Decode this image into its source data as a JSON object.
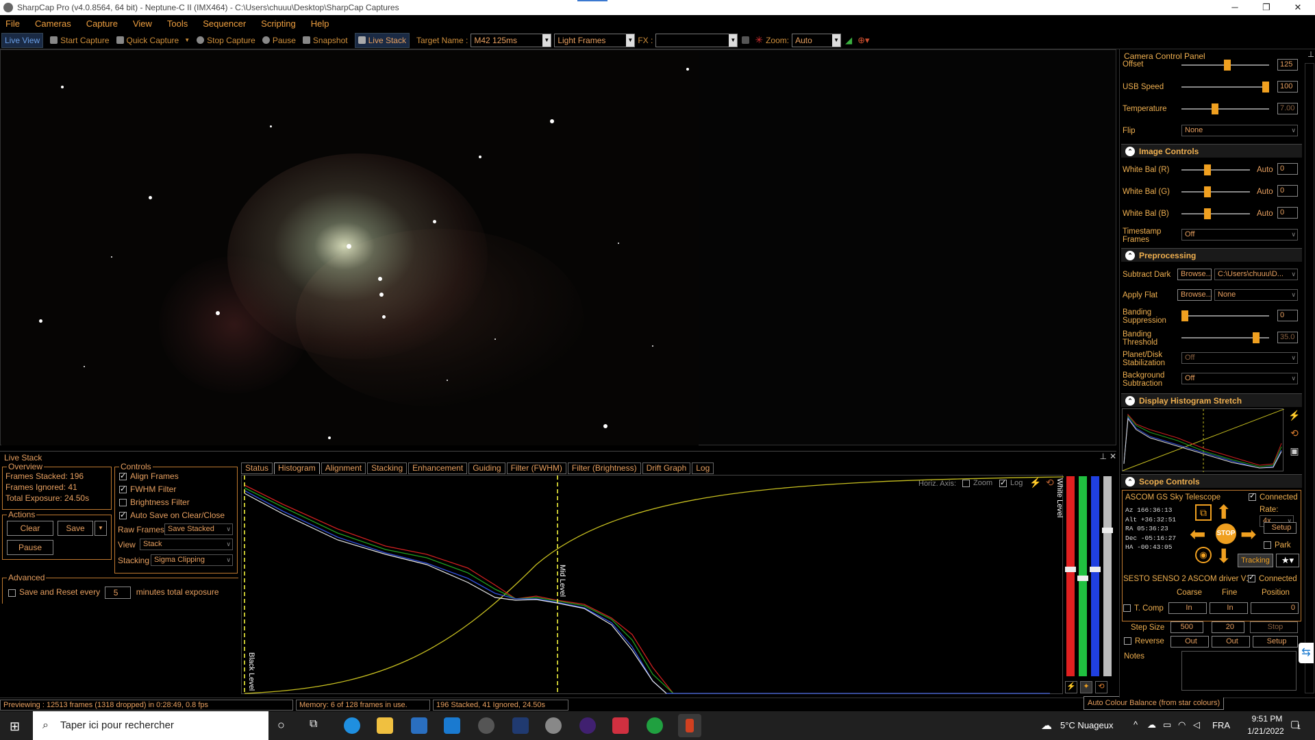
{
  "window": {
    "title": "SharpCap Pro (v4.0.8564, 64 bit) - Neptune-C II (IMX464) - C:\\Users\\chuuu\\Desktop\\SharpCap Captures"
  },
  "menu": [
    "File",
    "Cameras",
    "Capture",
    "View",
    "Tools",
    "Sequencer",
    "Scripting",
    "Help"
  ],
  "toolbar": {
    "live_view": "Live View",
    "start_capture": "Start Capture",
    "quick_capture": "Quick Capture",
    "stop_capture": "Stop Capture",
    "pause": "Pause",
    "snapshot": "Snapshot",
    "live_stack": "Live Stack",
    "target_label": "Target Name :",
    "target_value": "M42 125ms",
    "frame_type": "Light Frames",
    "fx_label": "FX :",
    "fx_value": "",
    "zoom_label": "Zoom:",
    "zoom_value": "Auto"
  },
  "livestack": {
    "title": "Live Stack",
    "overview": {
      "label": "Overview",
      "frames_stacked": "Frames Stacked: 196",
      "frames_ignored": "Frames Ignored:  41",
      "total_exposure": "Total Exposure:   24.50s"
    },
    "actions": {
      "label": "Actions",
      "clear": "Clear",
      "save": "Save",
      "pause": "Pause"
    },
    "advanced": {
      "label": "Advanced",
      "save_reset": "Save and Reset every",
      "minutes": "5",
      "minutes_suffix": "minutes total exposure"
    },
    "controls": {
      "label": "Controls",
      "align_frames": "Align Frames",
      "fwhm_filter": "FWHM Filter",
      "brightness_filter": "Brightness Filter",
      "auto_save": "Auto Save on Clear/Close",
      "raw_frames_label": "Raw Frames",
      "raw_frames_value": "Save Stacked",
      "view_label": "View",
      "view_value": "Stack",
      "stacking_label": "Stacking",
      "stacking_value": "Sigma Clipping"
    },
    "tabs": [
      "Status",
      "Histogram",
      "Alignment",
      "Stacking",
      "Enhancement",
      "Guiding",
      "Filter (FWHM)",
      "Filter (Brightness)",
      "Drift Graph",
      "Log"
    ],
    "selected_tab": "Histogram",
    "histogram": {
      "horiz_axis": "Horiz. Axis:",
      "zoom": "Zoom",
      "log": "Log",
      "mid_level": "Mid Level",
      "black_level": "Black Level",
      "white_level": "White Level"
    }
  },
  "status": {
    "previewing": "Previewing : 12513 frames (1318 dropped) in 0:28:49, 0.8 fps",
    "memory": "Memory: 6 of 128 frames in use.",
    "stacked": "196 Stacked, 41 Ignored, 24.50s",
    "tooltip": "Auto Colour Balance (from star colours)"
  },
  "right_panel": {
    "camera_control_title": "Camera Control Panel",
    "offset": {
      "label": "Offset",
      "value": "125",
      "level": 0.52
    },
    "usb_speed": {
      "label": "USB Speed",
      "value": "100",
      "level": 1.0
    },
    "temperature": {
      "label": "Temperature",
      "value": "7.00",
      "level": 0.38
    },
    "flip": {
      "label": "Flip",
      "value": "None"
    },
    "image_controls": {
      "title": "Image Controls",
      "wb_r": {
        "label": "White Bal (R)",
        "auto": "Auto",
        "value": "0",
        "level": 0.38
      },
      "wb_g": {
        "label": "White Bal (G)",
        "auto": "Auto",
        "value": "0",
        "level": 0.38
      },
      "wb_b": {
        "label": "White Bal (B)",
        "auto": "Auto",
        "value": "0",
        "level": 0.38
      },
      "timestamp_l1": "Timestamp",
      "timestamp_l2": "Frames",
      "timestamp_value": "Off"
    },
    "preprocessing": {
      "title": "Preprocessing",
      "subtract_dark": "Subtract Dark",
      "browse": "Browse...",
      "dark_value": "C:\\Users\\chuuu\\D...",
      "apply_flat": "Apply Flat",
      "flat_value": "None",
      "banding_supp_l1": "Banding",
      "banding_supp_l2": "Suppression",
      "banding_supp_value": "0",
      "banding_supp_level": 0.0,
      "banding_thr_l1": "Banding",
      "banding_thr_l2": "Threshold",
      "banding_thr_value": "35.0",
      "banding_thr_level": 0.85,
      "planet_l1": "Planet/Disk",
      "planet_l2": "Stabilization",
      "planet_value": "Off",
      "bg_l1": "Background",
      "bg_l2": "Subtraction",
      "bg_value": "Off"
    },
    "histogram_stretch": {
      "title": "Display Histogram Stretch"
    },
    "scope_controls": {
      "title": "Scope Controls",
      "telescope": "ASCOM GS Sky Telescope",
      "connected": "Connected",
      "rate_label": "Rate:",
      "rate_value": "4x",
      "setup": "Setup",
      "park": "Park",
      "stop": "STOP",
      "tracking": "Tracking",
      "coords": [
        {
          "k": "Az",
          "v": "166:36:13"
        },
        {
          "k": "Alt",
          "v": "+36:32:51"
        },
        {
          "k": "RA",
          "v": "05:36:23"
        },
        {
          "k": "Dec",
          "v": "-05:16:27"
        },
        {
          "k": "HA",
          "v": "-00:43:05"
        }
      ]
    },
    "focuser": {
      "name": "SESTO SENSO 2 ASCOM driver V1",
      "connected": "Connected",
      "coarse": "Coarse",
      "fine": "Fine",
      "position": "Position",
      "t_comp": "T. Comp",
      "in": "In",
      "position_value": "0",
      "step_size": "Step Size",
      "coarse_step": "500",
      "fine_step": "20",
      "stop": "Stop",
      "reverse": "Reverse",
      "out": "Out",
      "setup": "Setup"
    },
    "notes": "Notes"
  },
  "taskbar": {
    "search": "Taper ici pour rechercher",
    "weather": "5°C  Nuageux",
    "lang": "FRA",
    "time": "9:51 PM",
    "date": "1/21/2022",
    "notif": "1"
  }
}
